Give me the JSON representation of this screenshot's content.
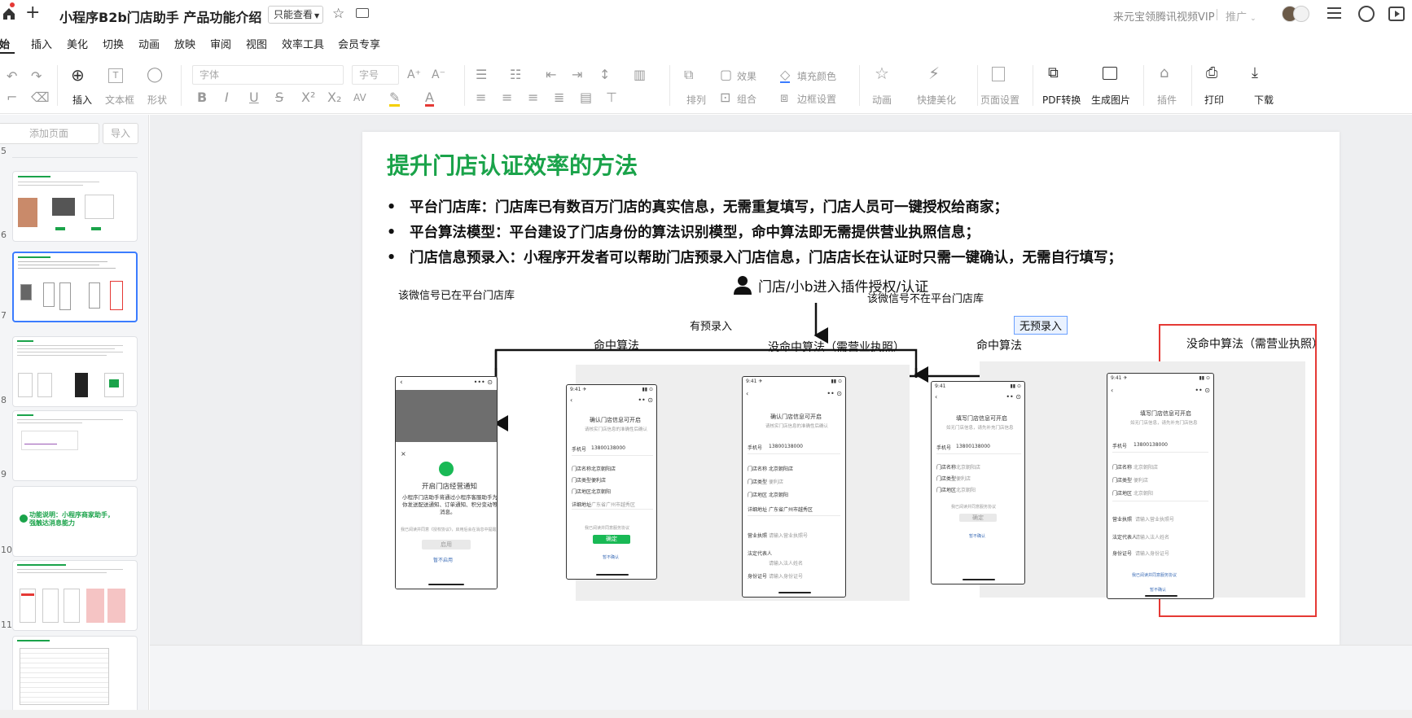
{
  "titlebar": {
    "doc_title": "小程序B2b门店助手 产品功能介绍",
    "mode": "只能查看",
    "vip_text": "来元宝领腾讯视频VIP",
    "promo": "推广"
  },
  "menu": [
    "开始",
    "插入",
    "美化",
    "切换",
    "动画",
    "放映",
    "审阅",
    "视图",
    "效率工具",
    "会员专享"
  ],
  "toolbar": {
    "insert": "插入",
    "textbox": "文本框",
    "shape": "形状",
    "font_placeholder": "字体",
    "size_placeholder": "字号",
    "effect": "效果",
    "fill": "填充颜色",
    "arrange": "排列",
    "group": "组合",
    "border": "边框设置",
    "animation": "动画",
    "quick_beautify": "快捷美化",
    "page_setup": "页面设置",
    "pdf": "PDF转换",
    "gen_image": "生成图片",
    "plugin": "插件",
    "print": "打印",
    "download": "下载"
  },
  "left_panel": {
    "add_page": "添加页面",
    "import": "导入",
    "slide_numbers": [
      "5",
      "6",
      "7",
      "8",
      "9",
      "10",
      "11"
    ],
    "slide10_text": "功能说明：小程序商家助手，强触达消息能力"
  },
  "slide": {
    "title": "提升门店认证效率的方法",
    "bullets": [
      "平台门店库：门店库已有数百万门店的真实信息，无需重复填写，门店人员可一键授权给商家；",
      "平台算法模型：平台建设了门店身份的算法识别模型，命中算法即无需提供营业执照信息；",
      "门店信息预录入：小程序开发者可以帮助门店预录入门店信息，门店店长在认证时只需一键确认，无需自行填写；"
    ],
    "diagram": {
      "root": "门店/小b进入插件授权/认证",
      "in_store_db": "该微信号已在平台门店库",
      "not_in_store_db": "该微信号不在平台门店库",
      "pre_entered": "有预录入",
      "not_pre_entered": "无预录入",
      "hit_algo_1": "命中算法",
      "miss_algo_1": "没命中算法（需营业执照）",
      "hit_algo_2": "命中算法",
      "miss_algo_2": "没命中算法（需营业执照）"
    },
    "phones": {
      "p1_title": "开启门店经营通知",
      "p1_body1": "小程序门店助手将通过小程序客服助手为",
      "p1_body2": "你发送配送通知、订单通知、积分变动等",
      "p1_body3": "消息。",
      "p1_agree": "我已阅读并同意《授权协议》，启用后会在消息中提醒",
      "p1_btn": "启用",
      "p1_link": "暂不启用",
      "confirm_title": "确认门店信息可开启",
      "confirm_sub": "请核实门店信息的准确性后确认",
      "fill_title": "填写门店信息可开启",
      "fill_sub": "如无门店信息，请先补充门店信息",
      "phone_lbl": "手机号",
      "phone_val": "13800138000",
      "name_lbl": "门店名称",
      "name_val": "北京朝阳店",
      "type_lbl": "门店类型",
      "type_val": "便利店",
      "region_lbl": "门店地区",
      "region_val": "北京朝阳",
      "addr_lbl": "详细地址",
      "addr_val": "广东省广州市越秀区",
      "license_lbl": "营业执照",
      "license_val": "请输入营业执照号",
      "legal_lbl": "法定代表人",
      "legal_val": "请输入法人姓名",
      "id_lbl": "身份证号",
      "id_val": "请输入身份证号",
      "agree": "我已阅读并同意服务协议",
      "confirm_btn": "确定",
      "skip": "暂不确认"
    }
  }
}
